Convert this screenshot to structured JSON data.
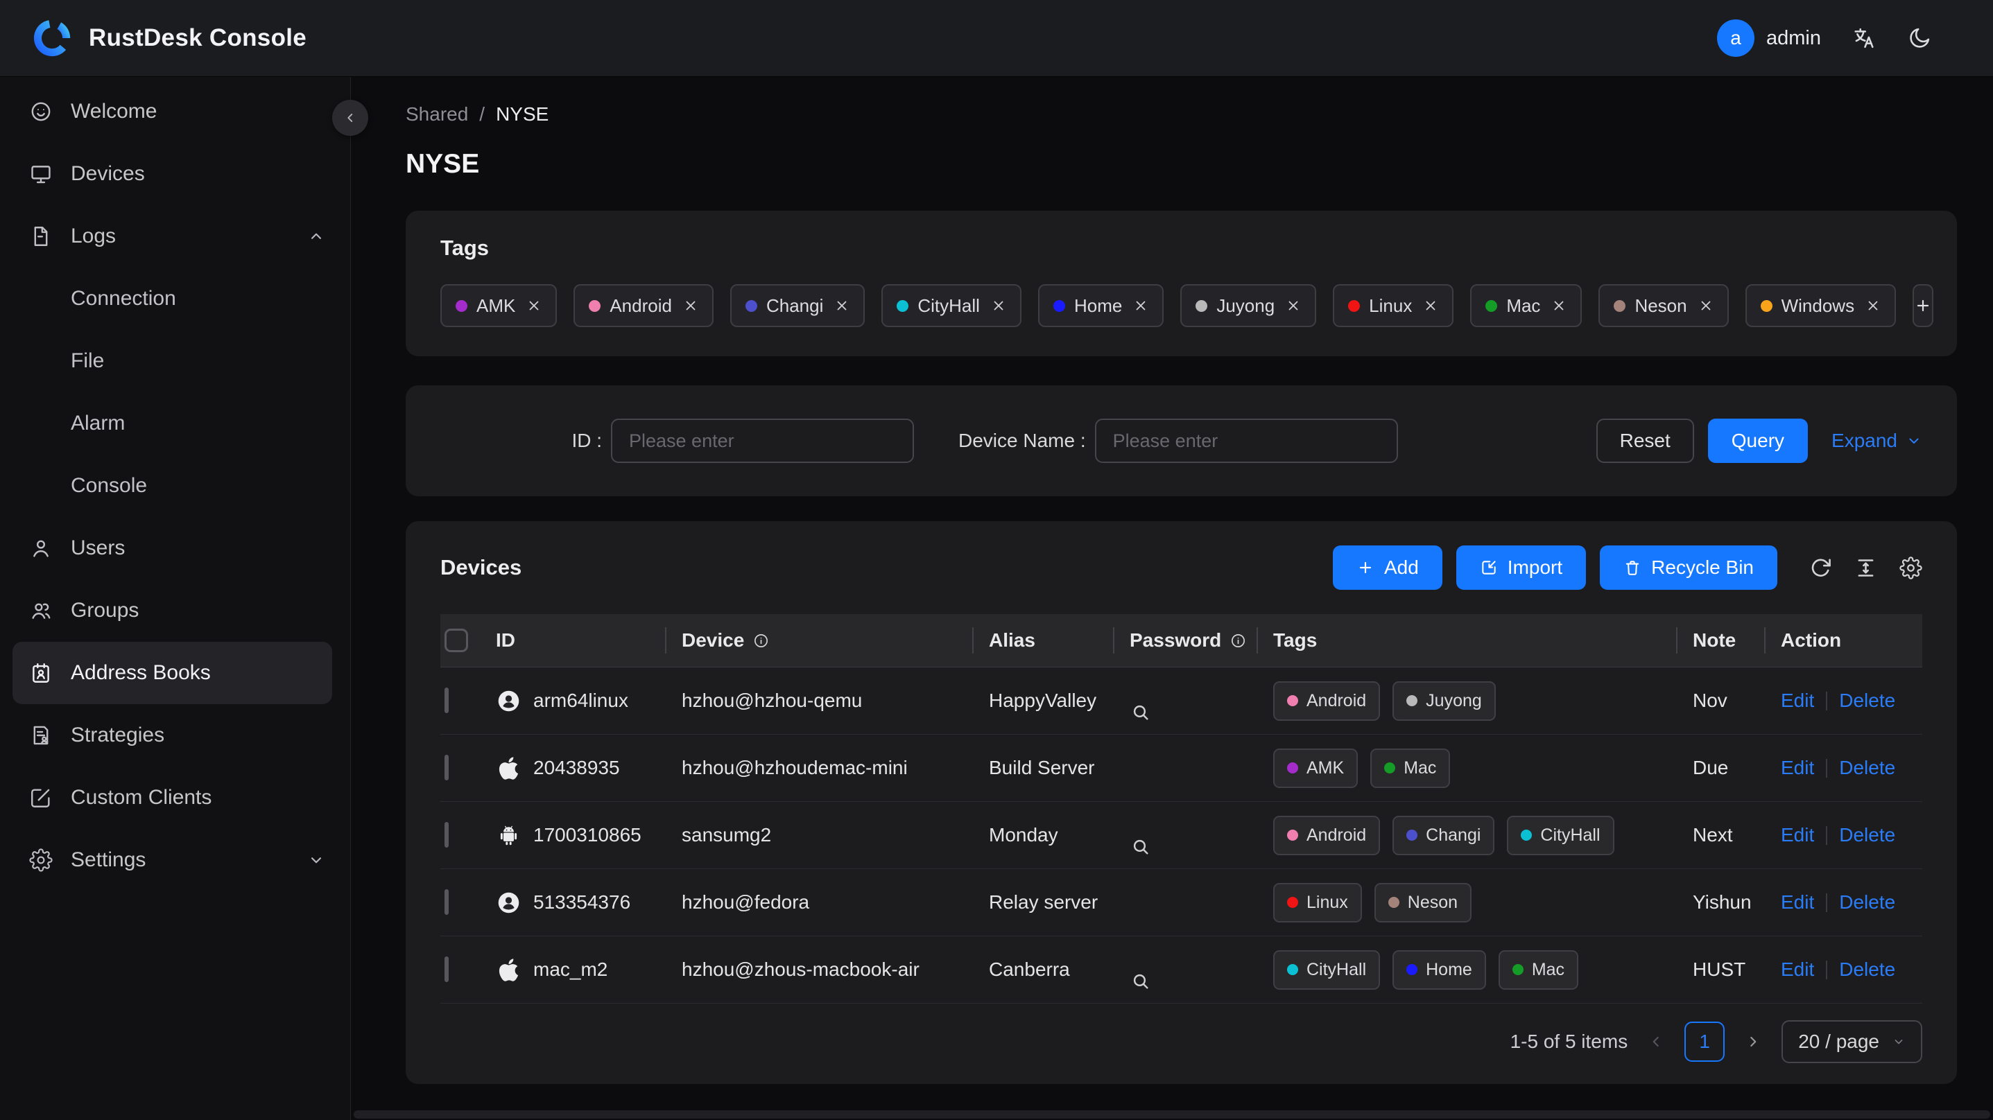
{
  "topbar": {
    "title": "RustDesk Console",
    "user_initial": "a",
    "user_name": "admin"
  },
  "sidebar": {
    "items": [
      {
        "id": "welcome",
        "label": "Welcome",
        "icon": "smiley"
      },
      {
        "id": "devices",
        "label": "Devices",
        "icon": "monitor"
      },
      {
        "id": "logs",
        "label": "Logs",
        "icon": "file-text",
        "chevron": "up",
        "children": [
          {
            "id": "connection",
            "label": "Connection"
          },
          {
            "id": "file",
            "label": "File"
          },
          {
            "id": "alarm",
            "label": "Alarm"
          },
          {
            "id": "console",
            "label": "Console"
          }
        ]
      },
      {
        "id": "users",
        "label": "Users",
        "icon": "user"
      },
      {
        "id": "groups",
        "label": "Groups",
        "icon": "users"
      },
      {
        "id": "address-books",
        "label": "Address Books",
        "icon": "address-book",
        "selected": true
      },
      {
        "id": "strategies",
        "label": "Strategies",
        "icon": "strategy"
      },
      {
        "id": "custom-clients",
        "label": "Custom Clients",
        "icon": "edit-square"
      },
      {
        "id": "settings",
        "label": "Settings",
        "icon": "gear",
        "chevron": "down"
      }
    ]
  },
  "breadcrumb": {
    "parent": "Shared",
    "separator": "/",
    "current": "NYSE"
  },
  "page": {
    "title": "NYSE"
  },
  "tag_colors": {
    "AMK": "#a32ccb",
    "Android": "#ee7fae",
    "Changi": "#4d50cc",
    "CityHall": "#0cc0d4",
    "Home": "#1b1bff",
    "Juyong": "#b9b9b9",
    "Linux": "#f01414",
    "Mac": "#149c27",
    "Neson": "#a3837a",
    "Windows": "#f9a41a"
  },
  "tags_card": {
    "title": "Tags",
    "tags": [
      "AMK",
      "Android",
      "Changi",
      "CityHall",
      "Home",
      "Juyong",
      "Linux",
      "Mac",
      "Neson",
      "Windows"
    ]
  },
  "filter": {
    "id_label": "ID :",
    "id_placeholder": "Please enter",
    "device_label": "Device Name :",
    "device_placeholder": "Please enter",
    "reset_label": "Reset",
    "query_label": "Query",
    "expand_label": "Expand"
  },
  "devices": {
    "title": "Devices",
    "add_label": "Add",
    "import_label": "Import",
    "recycle_label": "Recycle Bin"
  },
  "table": {
    "columns": [
      {
        "label": "ID"
      },
      {
        "label": "Device",
        "info": true
      },
      {
        "label": "Alias"
      },
      {
        "label": "Password",
        "info": true
      },
      {
        "label": "Tags"
      },
      {
        "label": "Note"
      },
      {
        "label": "Action"
      }
    ],
    "rows": [
      {
        "os": "linux",
        "id": "arm64linux",
        "device": "hzhou@hzhou-qemu",
        "alias": "HappyValley",
        "password_search": true,
        "tags": [
          "Android",
          "Juyong"
        ],
        "note": "Nov"
      },
      {
        "os": "apple",
        "id": "20438935",
        "device": "hzhou@hzhoudemac-mini",
        "alias": "Build Server",
        "password_search": false,
        "tags": [
          "AMK",
          "Mac"
        ],
        "note": "Due"
      },
      {
        "os": "android",
        "id": "1700310865",
        "device": "sansumg2",
        "alias": "Monday",
        "password_search": true,
        "tags": [
          "Android",
          "Changi",
          "CityHall"
        ],
        "note": "Next"
      },
      {
        "os": "linux",
        "id": "513354376",
        "device": "hzhou@fedora",
        "alias": "Relay server",
        "password_search": false,
        "tags": [
          "Linux",
          "Neson"
        ],
        "note": "Yishun"
      },
      {
        "os": "apple",
        "id": "mac_m2",
        "device": "hzhou@zhous-macbook-air",
        "alias": "Canberra",
        "password_search": true,
        "tags": [
          "CityHall",
          "Home",
          "Mac"
        ],
        "note": "HUST"
      }
    ],
    "actions": {
      "edit": "Edit",
      "delete": "Delete"
    }
  },
  "pagination": {
    "total": "1-5 of 5 items",
    "page": "1",
    "page_size": "20 / page"
  }
}
